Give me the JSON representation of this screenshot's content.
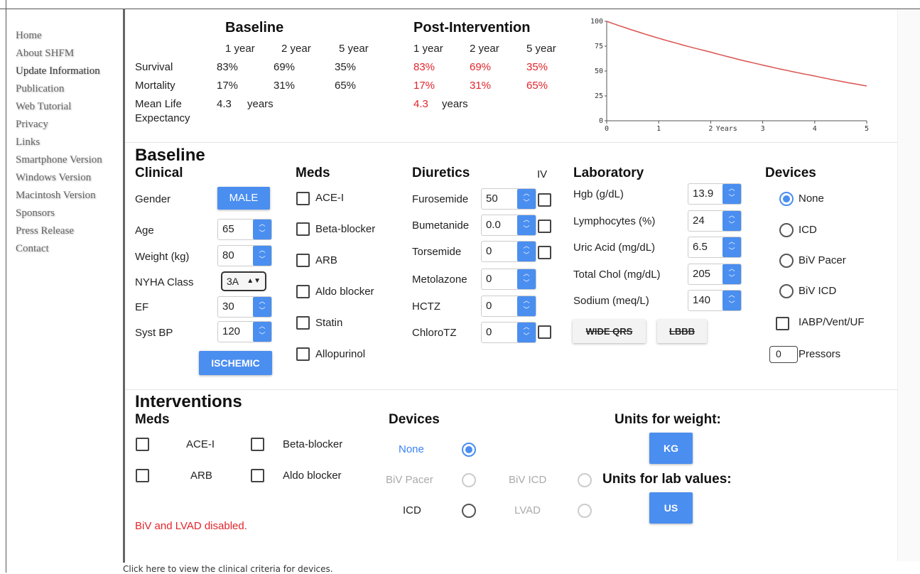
{
  "sidebar": {
    "items": [
      "Home",
      "About SHFM",
      "Update Information",
      "Publication",
      "Web Tutorial",
      "Privacy",
      "Links",
      "Smartphone Version",
      "Windows Version",
      "Macintosh Version",
      "Sponsors",
      "Press Release",
      "Contact"
    ]
  },
  "footer": "Click here to view the clinical criteria for devices.",
  "results": {
    "baseline_title": "Baseline",
    "post_title": "Post-Intervention",
    "years": [
      "1 year",
      "2 year",
      "5 year"
    ],
    "rows": {
      "survival_label": "Survival",
      "mortality_label": "Mortality",
      "mle_label1": "Mean Life",
      "mle_label2": "Expectancy"
    },
    "baseline": {
      "survival": [
        "83%",
        "69%",
        "35%"
      ],
      "mortality": [
        "17%",
        "31%",
        "65%"
      ],
      "mle": "4.3",
      "mle_unit": "years"
    },
    "post": {
      "survival": [
        "83%",
        "69%",
        "35%"
      ],
      "mortality": [
        "17%",
        "31%",
        "65%"
      ],
      "mle": "4.3",
      "mle_unit": "years"
    }
  },
  "chart_data": {
    "type": "line",
    "xlabel": "Years",
    "x_ticks": [
      "0",
      "1",
      "2",
      "3",
      "4",
      "5"
    ],
    "y_ticks": [
      "0",
      "25",
      "50",
      "75",
      "100"
    ],
    "xlim": [
      0,
      5
    ],
    "ylim": [
      0,
      100
    ],
    "series": [
      {
        "color": "#d9534f",
        "x": [
          0,
          1,
          2,
          3,
          4,
          5
        ],
        "y": [
          100,
          83,
          69,
          56,
          45,
          35
        ]
      }
    ]
  },
  "baseline_inputs": {
    "title": "Baseline",
    "clinical_title": "Clinical",
    "gender_label": "Gender",
    "gender_value": "MALE",
    "age_label": "Age",
    "age_value": "65",
    "weight_label": "Weight (kg)",
    "weight_value": "80",
    "nyha_label": "NYHA Class",
    "nyha_value": "3A",
    "ef_label": "EF",
    "ef_value": "30",
    "sbp_label": "Syst BP",
    "sbp_value": "120",
    "ischemic_label": "ISCHEMIC",
    "meds_title": "Meds",
    "meds": [
      "ACE-I",
      "Beta-blocker",
      "ARB",
      "Aldo blocker",
      "Statin",
      "Allopurinol"
    ],
    "diuretics_title": "Diuretics",
    "iv_label": "IV",
    "diuretics": [
      {
        "name": "Furosemide",
        "value": "50"
      },
      {
        "name": "Bumetanide",
        "value": "0.0"
      },
      {
        "name": "Torsemide",
        "value": "0"
      },
      {
        "name": "Metolazone",
        "value": "0"
      },
      {
        "name": "HCTZ",
        "value": "0"
      },
      {
        "name": "ChloroTZ",
        "value": "0"
      }
    ],
    "lab_title": "Laboratory",
    "labs": [
      {
        "name": "Hgb (g/dL)",
        "value": "13.9"
      },
      {
        "name": "Lymphocytes (%)",
        "value": "24"
      },
      {
        "name": "Uric Acid (mg/dL)",
        "value": "6.5"
      },
      {
        "name": "Total Chol (mg/dL)",
        "value": "205"
      },
      {
        "name": "Sodium (meq/L)",
        "value": "140"
      }
    ],
    "wide_qrs_label": "WIDE QRS",
    "lbbb_label": "LBBB",
    "devices_title": "Devices",
    "devices": [
      "None",
      "ICD",
      "BiV Pacer",
      "BiV ICD"
    ],
    "iabp_label": "IABP/Vent/UF",
    "pressors_value": "0",
    "pressors_label": "Pressors"
  },
  "interventions": {
    "title": "Interventions",
    "meds_title": "Meds",
    "meds": [
      "ACE-I",
      "Beta-blocker",
      "ARB",
      "Aldo blocker"
    ],
    "warning": "BiV and LVAD disabled.",
    "devices_title": "Devices",
    "dev_none": "None",
    "dev_biv_pacer": "BiV Pacer",
    "dev_biv_icd": "BiV ICD",
    "dev_icd": "ICD",
    "dev_lvad": "LVAD",
    "units_weight_label": "Units for weight:",
    "units_weight_value": "KG",
    "units_lab_label": "Units for lab values:",
    "units_lab_value": "US"
  }
}
